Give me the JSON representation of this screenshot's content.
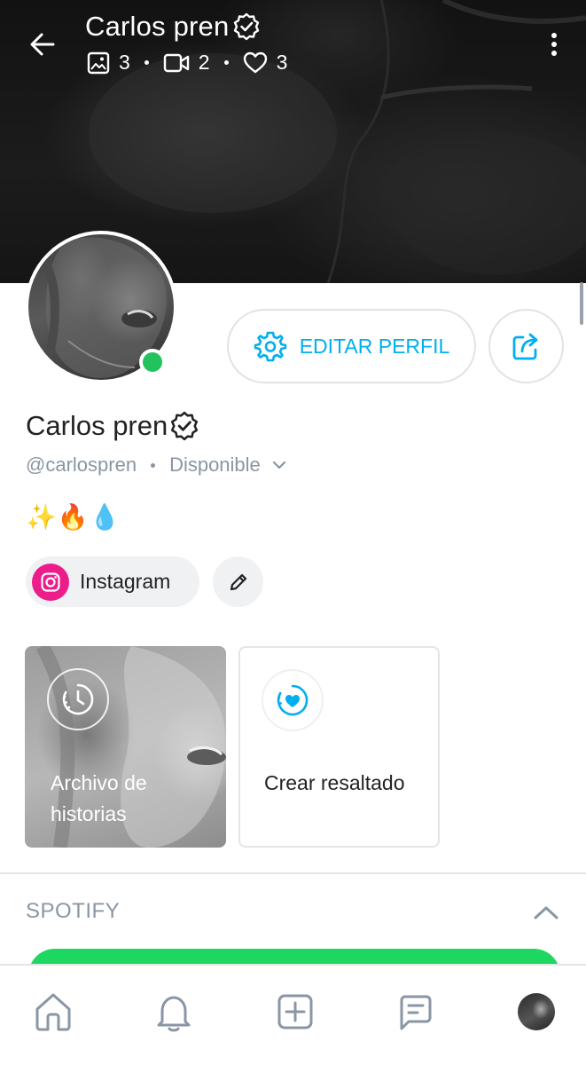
{
  "header": {
    "back_icon": "arrow-left-icon",
    "title": "Carlos pren",
    "stats": {
      "photos": "3",
      "videos": "2",
      "likes": "3"
    },
    "more_icon": "more-vertical-icon"
  },
  "profile": {
    "name": "Carlos pren",
    "handle": "@carlospren",
    "status": "Disponible",
    "bio": "✨🔥💧",
    "online": true,
    "online_color": "#22c35e"
  },
  "actions": {
    "edit_label": "EDITAR PERFIL",
    "accent": "#00aff0"
  },
  "social": {
    "instagram_label": "Instagram",
    "instagram_color": "#ec1c8a"
  },
  "highlights": [
    {
      "label": "Archivo de historias",
      "icon": "history-clock-icon"
    },
    {
      "label": "Crear resaltado",
      "icon": "heart-circle-icon"
    }
  ],
  "spotify": {
    "section_title": "SPOTIFY",
    "bar_color": "#1ed760"
  },
  "bottom_nav": [
    "home-icon",
    "bell-icon",
    "add-square-icon",
    "messages-icon",
    "profile-avatar"
  ]
}
